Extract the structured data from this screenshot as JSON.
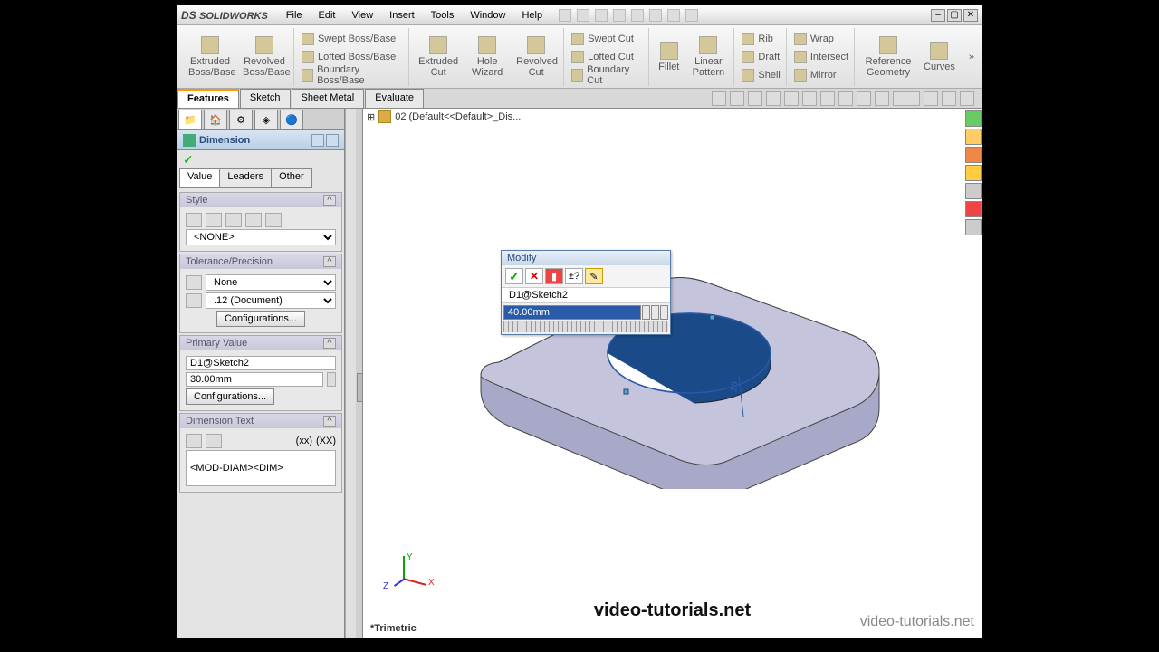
{
  "app": {
    "name": "SOLIDWORKS"
  },
  "menu": {
    "file": "File",
    "edit": "Edit",
    "view": "View",
    "insert": "Insert",
    "tools": "Tools",
    "window": "Window",
    "help": "Help"
  },
  "ribbon": {
    "extruded_boss": "Extruded Boss/Base",
    "revolved_boss": "Revolved Boss/Base",
    "swept_boss": "Swept Boss/Base",
    "lofted_boss": "Lofted Boss/Base",
    "boundary_boss": "Boundary Boss/Base",
    "extruded_cut": "Extruded Cut",
    "hole_wizard": "Hole Wizard",
    "revolved_cut": "Revolved Cut",
    "swept_cut": "Swept Cut",
    "lofted_cut": "Lofted Cut",
    "boundary_cut": "Boundary Cut",
    "fillet": "Fillet",
    "linear_pattern": "Linear Pattern",
    "rib": "Rib",
    "draft": "Draft",
    "shell": "Shell",
    "wrap": "Wrap",
    "intersect": "Intersect",
    "mirror": "Mirror",
    "ref_geom": "Reference Geometry",
    "curves": "Curves"
  },
  "tabs": {
    "features": "Features",
    "sketch": "Sketch",
    "sheet_metal": "Sheet Metal",
    "evaluate": "Evaluate"
  },
  "panel": {
    "title": "Dimension",
    "subtabs": {
      "value": "Value",
      "leaders": "Leaders",
      "other": "Other"
    },
    "style": {
      "title": "Style",
      "select": "<NONE>"
    },
    "tolerance": {
      "title": "Tolerance/Precision",
      "type": "None",
      "precision": ".12 (Document)",
      "config": "Configurations..."
    },
    "primary": {
      "title": "Primary Value",
      "name": "D1@Sketch2",
      "value": "30.00mm",
      "config": "Configurations..."
    },
    "dimtext": {
      "title": "Dimension Text",
      "value": "<MOD-DIAM><DIM>",
      "xx1": "(xx)",
      "xx2": "(XX)"
    }
  },
  "breadcrumb": {
    "text": "02 (Default<<Default>_Dis..."
  },
  "modify": {
    "title": "Modify",
    "name": "D1@Sketch2",
    "value": "40.00mm",
    "tol": "±?"
  },
  "viewport": {
    "dim_label": "10",
    "view": "*Trimetric"
  },
  "triad": {
    "x": "X",
    "y": "Y",
    "z": "Z"
  },
  "watermark": {
    "main": "video-tutorials.net",
    "corner": "video-tutorials.net"
  }
}
